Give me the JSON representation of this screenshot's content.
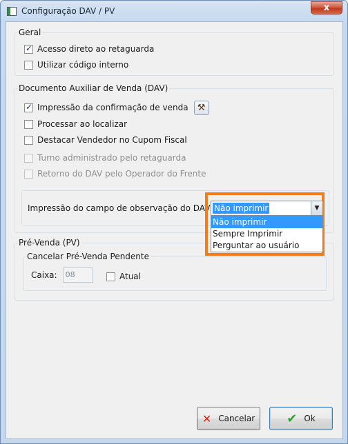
{
  "window": {
    "title": "Configuração DAV / PV",
    "close_glyph": "x"
  },
  "geral": {
    "legend": "Geral",
    "items": [
      {
        "label": "Acesso direto ao retaguarda",
        "checked": true
      },
      {
        "label": "Utilizar código interno",
        "checked": false
      }
    ]
  },
  "dav": {
    "legend": "Documento Auxiliar de Venda (DAV)",
    "items": [
      {
        "label": "Impressão da confirmação de venda",
        "checked": true,
        "disabled": false
      },
      {
        "label": "Processar ao localizar",
        "checked": false,
        "disabled": false
      },
      {
        "label": "Destacar Vendedor no Cupom Fiscal",
        "checked": false,
        "disabled": false
      },
      {
        "label": "Turno administrado pelo retaguarda",
        "checked": false,
        "disabled": true
      },
      {
        "label": "Retorno do DAV pelo Operador do Frente",
        "checked": false,
        "disabled": true
      }
    ],
    "tool_icon": "hammer-icon",
    "obs_label": "Impressão do campo de observação do DAV:",
    "obs_selected": "Não imprimir",
    "obs_options": [
      "Não imprimir",
      "Sempre Imprimir",
      "Perguntar ao usuário"
    ]
  },
  "prevenda": {
    "legend": "Pré-Venda (PV)",
    "cancel_legend": "Cancelar Pré-Venda Pendente",
    "caixa_label": "Caixa:",
    "caixa_value": "08",
    "atual_label": "Atual",
    "atual_checked": false
  },
  "buttons": {
    "cancel": "Cancelar",
    "ok": "Ok"
  },
  "colors": {
    "highlight": "#f07d1e",
    "selection": "#3399ff"
  }
}
